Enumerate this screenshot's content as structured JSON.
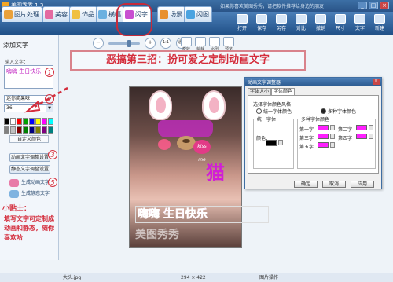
{
  "window": {
    "title": "美图秀秀 1.3",
    "notice": "如果你喜欢美图秀秀，请把软件推荐给身边的朋友！",
    "controls": [
      "_",
      "□",
      "×"
    ]
  },
  "tabs": [
    {
      "label": "图片处理",
      "color": "#e9a13b"
    },
    {
      "label": "美容",
      "color": "#e46aa0"
    },
    {
      "label": "饰品",
      "color": "#f0c040"
    },
    {
      "label": "横幅",
      "color": "#6ab0e0"
    },
    {
      "label": "闪字",
      "color": "#c84fd1"
    },
    {
      "label": "场景",
      "color": "#e8902e"
    },
    {
      "label": "闪图",
      "color": "#4aa3e0"
    }
  ],
  "toolbar": [
    "打开",
    "保存",
    "另存",
    "对比",
    "撤销",
    "尺寸",
    "文字",
    "新建"
  ],
  "left_panel": {
    "title": "添加文字",
    "input_label": "输入文字：",
    "text_value": "嗨嗨 生日快乐",
    "font": "迷你简果味",
    "size": "36",
    "swatches": [
      "#000000",
      "#ffffff",
      "#ff0000",
      "#00a000",
      "#0000ff",
      "#ffff00",
      "#ff00ff",
      "#00ffff",
      "#808080",
      "#c0c0c0",
      "#800000",
      "#008000",
      "#000080",
      "#808000",
      "#800080",
      "#008080"
    ],
    "custom_color": "自定义颜色",
    "btn_anim_style": "动画文字调整设置",
    "btn_static_style": "静态文字调整设置",
    "btn_gen_anim": "生成动画文字",
    "btn_gen_static": "生成静态文字",
    "tip_title": "小贴士：",
    "tip_body": "填写文字可定制成动画和静态，随你喜欢哈"
  },
  "view_tools": [
    "−",
    "+",
    "1:1",
    "适应"
  ],
  "side_tools": [
    "旋转",
    "剪裁",
    "比例",
    "预览"
  ],
  "headline": "恶搞第三招：扮可爱之定制动画文字",
  "markers": [
    "1",
    "2",
    "3",
    "4",
    "5"
  ],
  "photo": {
    "kiss_label": "kiss me",
    "cat_text": "猫",
    "overlay_text": "嗨嗨 生日快乐",
    "watermark": "美图秀秀"
  },
  "dialog": {
    "title": "动画文字调整器",
    "close": "×",
    "tabs": [
      "字体大小",
      "字体颜色"
    ],
    "style_label": "选择字体颜色风格",
    "radio_single": "统一字体颜色",
    "radio_multi": "多种字体颜色",
    "group_single": "统一字体",
    "color_label": "颜色：",
    "group_multi": "多种字体颜色",
    "color_rows": [
      "第一字",
      "第二字",
      "第三字",
      "第四字",
      "第五字"
    ],
    "ok": "确定",
    "cancel": "取消",
    "apply": "应用"
  },
  "status": {
    "file": "大头.jpg",
    "dims": "294 × 422",
    "mode": "图片操作"
  }
}
